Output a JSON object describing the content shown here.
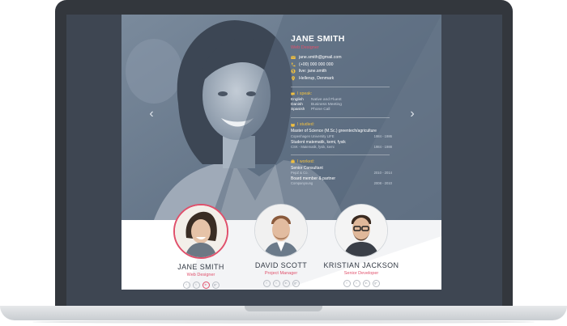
{
  "profile": {
    "name": "JANE SMITH",
    "title": "Web Designer",
    "contact": {
      "email": "jane.smith@gmail.com",
      "phone": "(+00) 000 000 000",
      "skype": "live: jane.smith",
      "location": "Hellerup, Denmark"
    },
    "languages": {
      "heading": "I speak:",
      "items": [
        {
          "lang": "English",
          "level": "Native and Fluent"
        },
        {
          "lang": "Danish",
          "level": "Business Meeting"
        },
        {
          "lang": "Spanish",
          "level": "Phone Call"
        }
      ]
    },
    "education": {
      "heading": "I studied:",
      "items": [
        {
          "degree": "Master of Science (M.Sc.) greentech/agriculture",
          "school": "Copenhagen University LIFE",
          "years": "1984 - 1986"
        },
        {
          "degree": "Student matematik, kemi, fysik",
          "school": "CSK - Matematik, fysik, kemi",
          "years": "1984 - 1988"
        }
      ]
    },
    "work": {
      "heading": "I worked:",
      "items": [
        {
          "role": "Senior Consultant",
          "company": "PepZ & Co.",
          "years": "2010 - 2014"
        },
        {
          "role": "Board member & partner",
          "company": "Companyoung",
          "years": "2008 - 2010"
        }
      ]
    }
  },
  "nav": {
    "prev": "‹",
    "next": "›"
  },
  "team": [
    {
      "name": "JANE SMITH",
      "role": "Web Designer",
      "socials": [
        "f",
        "t",
        "in",
        "g+"
      ]
    },
    {
      "name": "DAVID SCOTT",
      "role": "Project Manager",
      "socials": [
        "f",
        "t",
        "in",
        "g+"
      ]
    },
    {
      "name": "KRISTIAN JACKSON",
      "role": "Senior Developer",
      "socials": [
        "f",
        "t",
        "in",
        "g+"
      ]
    }
  ],
  "colors": {
    "accent": "#e0506b",
    "highlight": "#f1c040",
    "hero": "#5f6f82"
  }
}
